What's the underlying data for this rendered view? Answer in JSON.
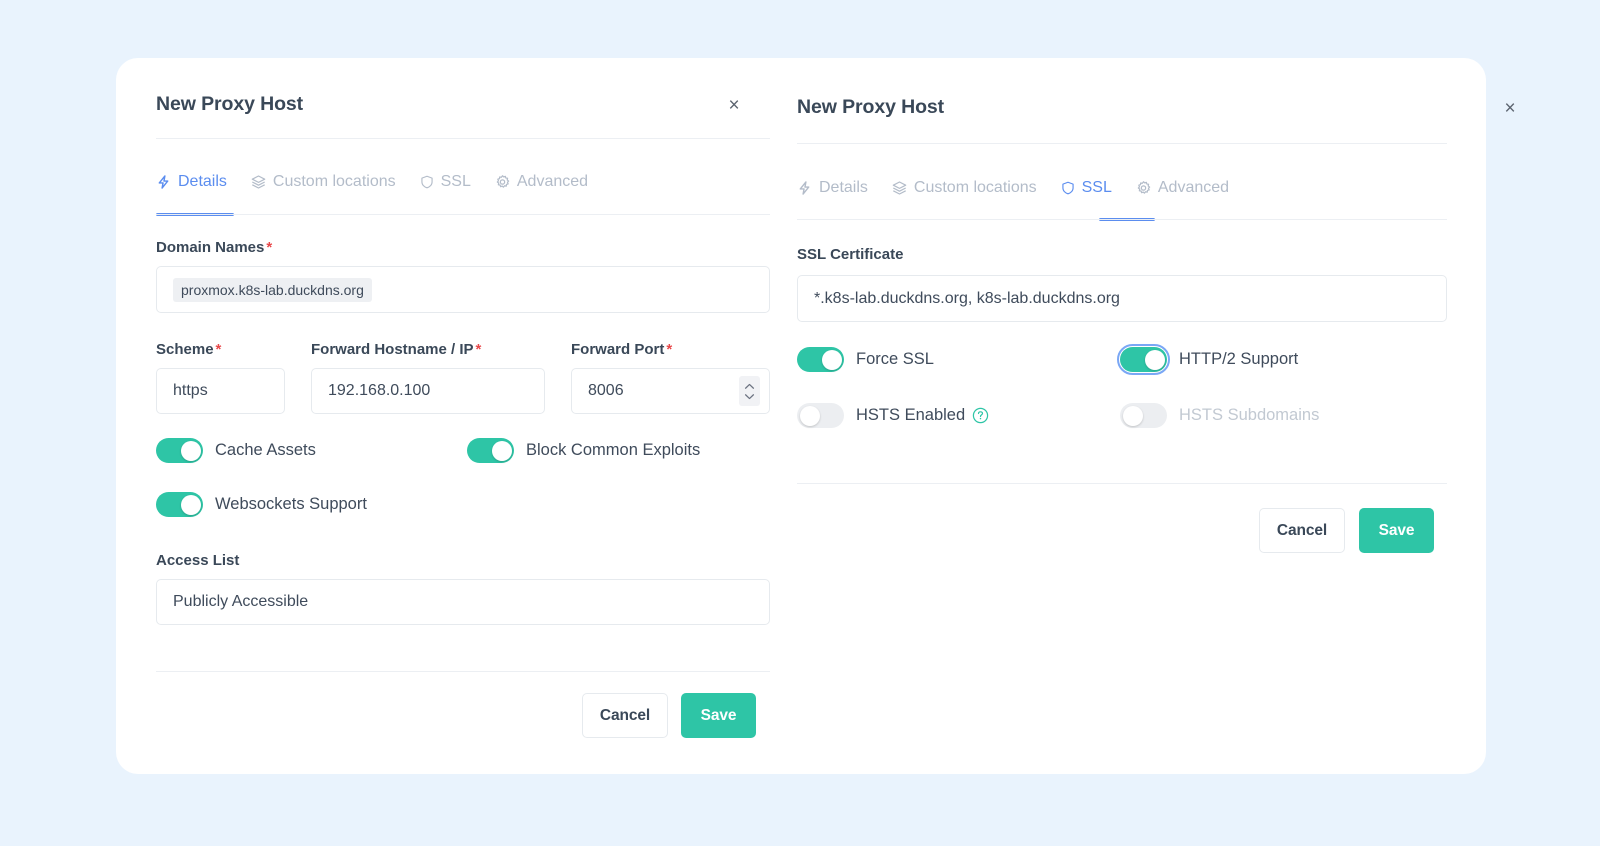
{
  "background_color": "#e9f3fd",
  "accent_color": "#2ec5a6",
  "link_color": "#5b8def",
  "required_color": "#e8484a",
  "left_panel": {
    "title": "New Proxy Host",
    "close_label": "×",
    "tabs": [
      {
        "label": "Details",
        "icon": "lightning-icon",
        "active": true
      },
      {
        "label": "Custom locations",
        "icon": "layers-icon",
        "active": false
      },
      {
        "label": "SSL",
        "icon": "shield-icon",
        "active": false
      },
      {
        "label": "Advanced",
        "icon": "gear-icon",
        "active": false
      }
    ],
    "domain_names": {
      "label": "Domain Names",
      "required": "*",
      "chips": [
        "proxmox.k8s-lab.duckdns.org"
      ]
    },
    "scheme": {
      "label": "Scheme",
      "required": "*",
      "value": "https"
    },
    "forward_hostname": {
      "label": "Forward Hostname / IP",
      "required": "*",
      "value": "192.168.0.100"
    },
    "forward_port": {
      "label": "Forward Port",
      "required": "*",
      "value": "8006"
    },
    "toggles": [
      {
        "label": "Cache Assets",
        "on": true
      },
      {
        "label": "Block Common Exploits",
        "on": true
      },
      {
        "label": "Websockets Support",
        "on": true
      }
    ],
    "access_list": {
      "label": "Access List",
      "value": "Publicly Accessible"
    },
    "cancel_label": "Cancel",
    "save_label": "Save"
  },
  "right_panel": {
    "title": "New Proxy Host",
    "close_label": "×",
    "tabs": [
      {
        "label": "Details",
        "icon": "lightning-icon",
        "active": false
      },
      {
        "label": "Custom locations",
        "icon": "layers-icon",
        "active": false
      },
      {
        "label": "SSL",
        "icon": "shield-icon",
        "active": true
      },
      {
        "label": "Advanced",
        "icon": "gear-icon",
        "active": false
      }
    ],
    "ssl_certificate": {
      "label": "SSL Certificate",
      "value": "*.k8s-lab.duckdns.org, k8s-lab.duckdns.org"
    },
    "toggles": [
      {
        "label": "Force SSL",
        "on": true,
        "disabled": false,
        "focused": false
      },
      {
        "label": "HTTP/2 Support",
        "on": true,
        "disabled": false,
        "focused": true
      },
      {
        "label": "HSTS Enabled",
        "on": false,
        "disabled": false,
        "focused": false,
        "help": "?"
      },
      {
        "label": "HSTS Subdomains",
        "on": false,
        "disabled": true,
        "focused": false
      }
    ],
    "cancel_label": "Cancel",
    "save_label": "Save"
  }
}
